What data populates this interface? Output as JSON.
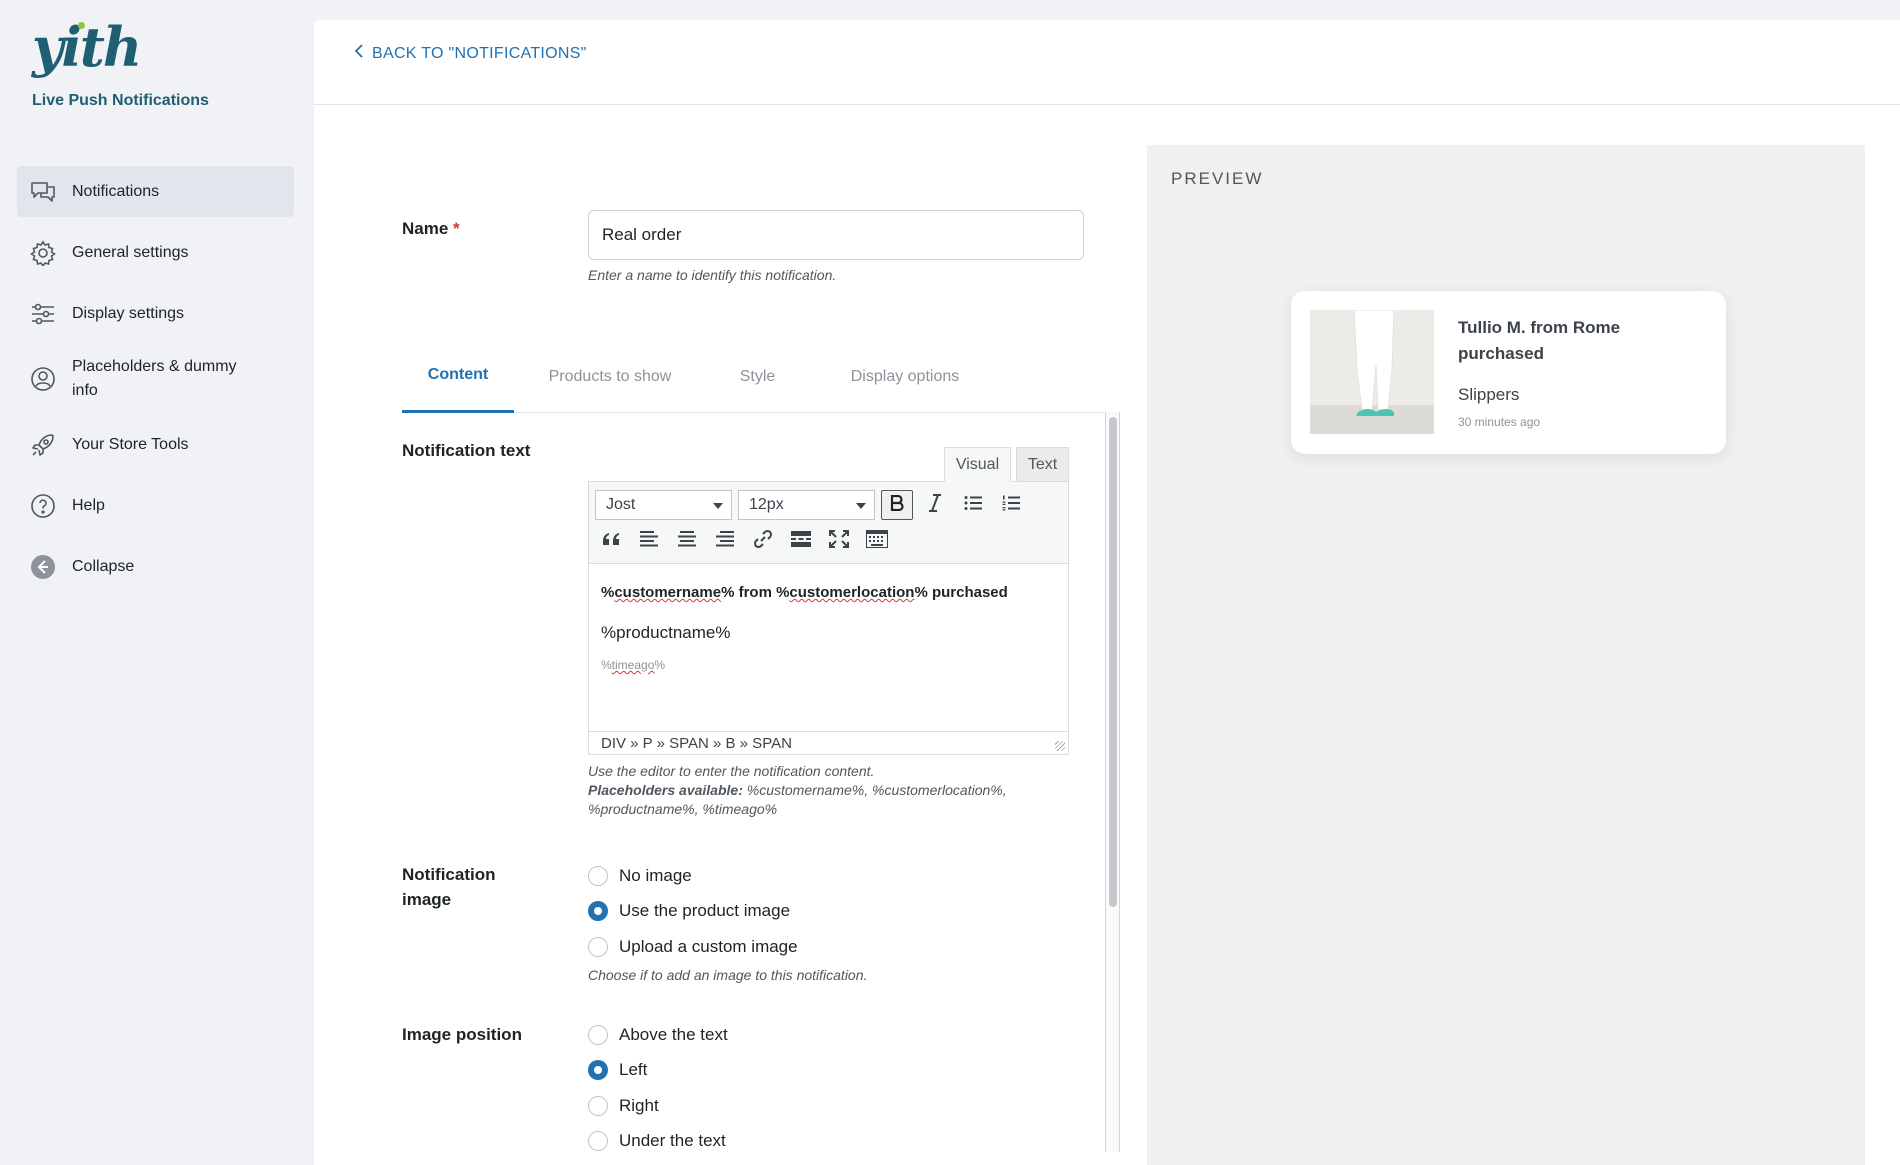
{
  "brand": {
    "logo": "yith",
    "plugin_name": "Live Push Notifications"
  },
  "sidebar": {
    "items": [
      {
        "label": "Notifications",
        "icon": "chat-bubbles-icon",
        "active": true
      },
      {
        "label": "General settings",
        "icon": "gear-icon"
      },
      {
        "label": "Display settings",
        "icon": "sliders-icon"
      },
      {
        "label": "Placeholders & dummy info",
        "icon": "user-circle-icon"
      },
      {
        "label": "Your Store Tools",
        "icon": "rocket-icon"
      },
      {
        "label": "Help",
        "icon": "question-circle-icon"
      },
      {
        "label": "Collapse",
        "icon": "collapse-arrow-icon"
      }
    ]
  },
  "topbar": {
    "back_label": "BACK TO \"NOTIFICATIONS\""
  },
  "form": {
    "name": {
      "label": "Name",
      "required_mark": "*",
      "value": "Real order",
      "description": "Enter a name to identify this notification."
    },
    "tabs": [
      "Content",
      "Products to show",
      "Style",
      "Display options"
    ],
    "active_tab": "Content",
    "notification_text": {
      "label": "Notification text",
      "editor_tabs": {
        "visual": "Visual",
        "text": "Text"
      },
      "font_family": "Jost",
      "font_size": "12px",
      "content": {
        "line1_parts": [
          "%",
          "customername",
          "% from %",
          "customerlocation",
          "% purchased"
        ],
        "line2": "%productname%",
        "line3_parts": [
          "%",
          "timeago",
          "%"
        ]
      },
      "path": "DIV » P » SPAN » B » SPAN",
      "description": "Use the editor to enter the notification content.",
      "placeholders_label": "Placeholders available:",
      "placeholders_list": " %customername%, %customerlocation%, %productname%, %timeago%"
    },
    "notification_image": {
      "label": "Notification image",
      "options": [
        "No image",
        "Use the product image",
        "Upload a custom image"
      ],
      "selected": "Use the product image",
      "description": "Choose if to add an image to this notification."
    },
    "image_position": {
      "label": "Image position",
      "options": [
        "Above the text",
        "Left",
        "Right",
        "Under the text"
      ],
      "selected": "Left"
    }
  },
  "preview": {
    "title": "PREVIEW",
    "card": {
      "title": "Tullio M. from Rome purchased",
      "product": "Slippers",
      "time": "30 minutes ago"
    }
  },
  "colors": {
    "accent": "#2271b1",
    "brand": "#1f5f74",
    "required": "#d63638"
  }
}
